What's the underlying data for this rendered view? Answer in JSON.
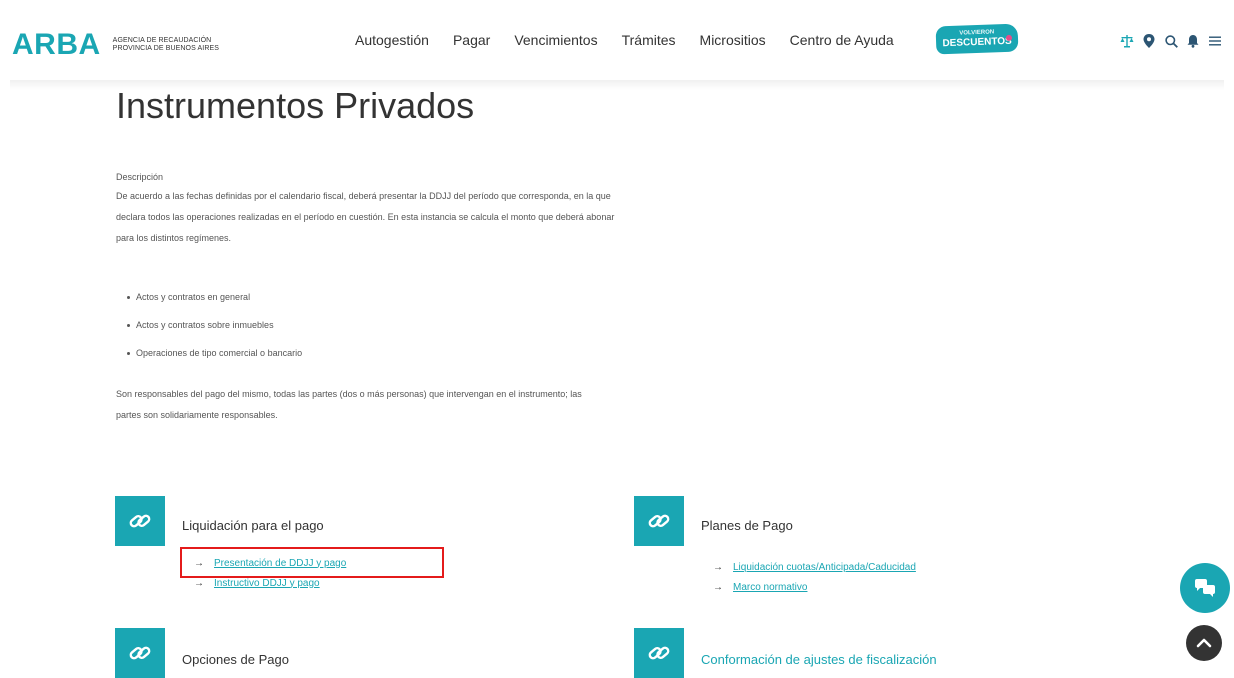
{
  "header": {
    "logo": {
      "word": "ARBA",
      "line1": "AGENCIA DE RECAUDACIÓN",
      "line2": "PROVINCIA DE BUENOS AIRES"
    },
    "nav": [
      {
        "label": "Autogestión"
      },
      {
        "label": "Pagar"
      },
      {
        "label": "Vencimientos"
      },
      {
        "label": "Trámites"
      },
      {
        "label": "Micrositios"
      },
      {
        "label": "Centro de Ayuda"
      }
    ],
    "promo": {
      "top": "VOLVIERON",
      "main": "DESCUENTOS"
    },
    "icons": [
      "balance-scale-icon",
      "location-pin-icon",
      "search-icon",
      "bell-icon",
      "menu-icon"
    ]
  },
  "main": {
    "title": "Instrumentos Privados",
    "description_label": "Descripción",
    "description": "De acuerdo a las fechas definidas por el calendario fiscal, deberá presentar la DDJJ del período que corresponda, en la que declara todos las operaciones realizadas en el período en cuestión. En esta instancia se calcula el monto que deberá abonar para los distintos regímenes.",
    "bullets": [
      "Actos y contratos en general",
      "Actos y contratos sobre inmuebles",
      "Operaciones de tipo comercial o bancario"
    ],
    "responsibility": "Son responsables del pago del mismo, todas las partes (dos o más personas) que intervengan en el instrumento; las partes son solidariamente responsables."
  },
  "sections": {
    "liquidacion": {
      "title": "Liquidación para el pago",
      "links": [
        "Presentación de DDJJ y pago",
        "Instructivo DDJJ y pago"
      ]
    },
    "planes": {
      "title": "Planes de Pago",
      "links": [
        "Liquidación cuotas/Anticipada/Caducidad",
        "Marco normativo"
      ]
    },
    "opciones": {
      "title": "Opciones de Pago"
    },
    "conformacion": {
      "title": "Conformación de ajustes de fiscalización"
    }
  },
  "arrow_glyph": "→",
  "colors": {
    "brand": "#1aa6b3",
    "text": "#333333",
    "highlight": "#e41b1b",
    "promo_dot": "#e64c8a"
  }
}
